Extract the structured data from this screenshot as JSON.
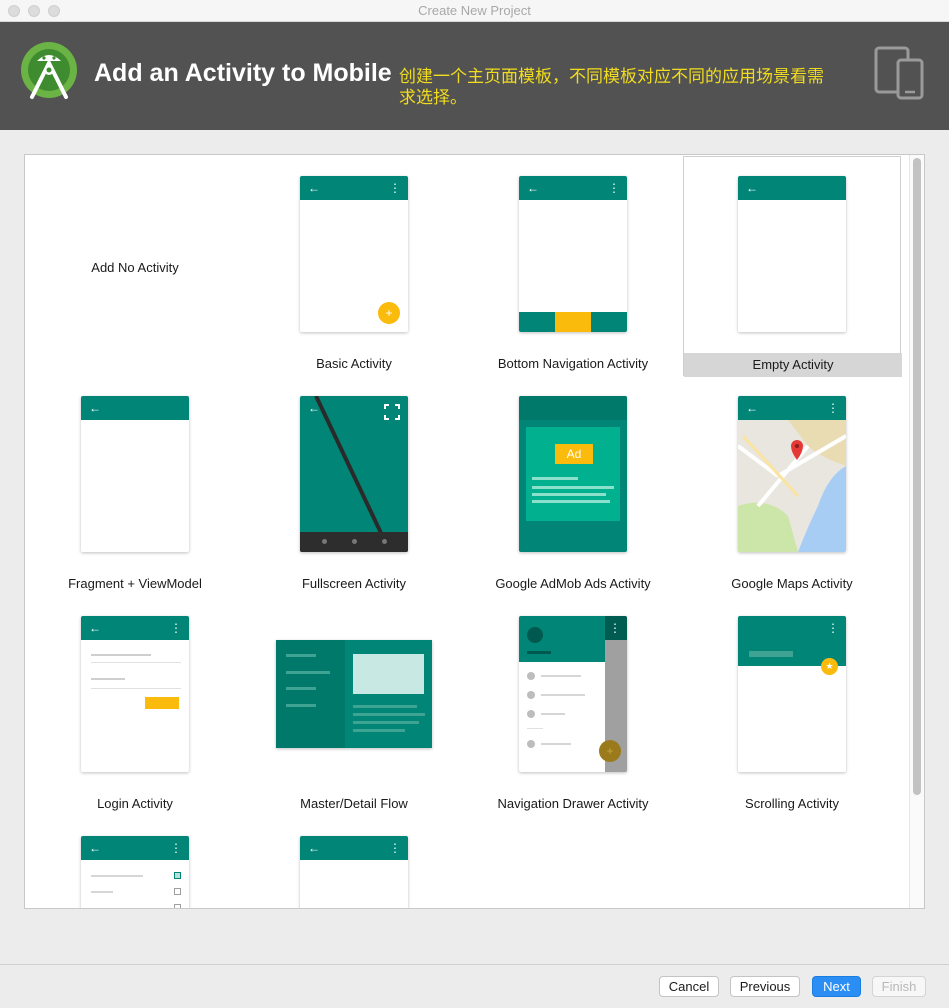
{
  "window": {
    "title": "Create New Project"
  },
  "header": {
    "title": "Add an Activity to Mobile",
    "note": "创建一个主页面模板，不同模板对应不同的应用场景看需求选择。"
  },
  "templates": [
    {
      "label": "Add No Activity"
    },
    {
      "label": "Basic Activity"
    },
    {
      "label": "Bottom Navigation Activity"
    },
    {
      "label": "Empty Activity",
      "selected": true
    },
    {
      "label": "Fragment + ViewModel"
    },
    {
      "label": "Fullscreen Activity"
    },
    {
      "label": "Google AdMob Ads Activity",
      "badge": "Ad"
    },
    {
      "label": "Google Maps Activity"
    },
    {
      "label": "Login Activity"
    },
    {
      "label": "Master/Detail Flow"
    },
    {
      "label": "Navigation Drawer Activity"
    },
    {
      "label": "Scrolling Activity"
    }
  ],
  "footer": {
    "cancel": "Cancel",
    "previous": "Previous",
    "next": "Next",
    "finish": "Finish"
  },
  "colors": {
    "accent": "#008577",
    "fab": "#fbbb0c",
    "header_bg": "#525252",
    "note_text": "#f1dc1e",
    "primary_button": "#2a8ef5"
  },
  "icons": {
    "back": "←",
    "overflow": "⋮",
    "fab_plus": "+",
    "star": "★",
    "fullscreen": "⛶"
  }
}
